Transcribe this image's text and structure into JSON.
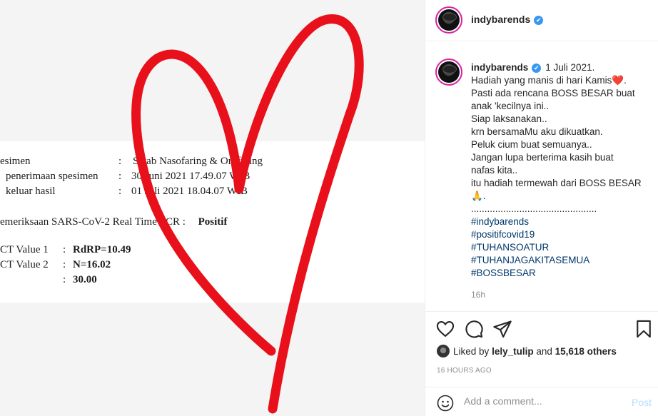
{
  "document": {
    "rows": [
      {
        "label": "esimen",
        "value": "Swab Nasofaring & Orofaring"
      },
      {
        "label": "penerimaan spesimen",
        "value": "30 Juni 2021 17.49.07 WIB"
      },
      {
        "label": "keluar hasil",
        "value": "01 Juli 2021 18.04.07 WIB"
      }
    ],
    "result_label": "emeriksaan SARS-CoV-2 Real Time PCR :",
    "result_value": "Positif",
    "ct_rows": [
      {
        "label": "CT Value 1",
        "value": "RdRP=10.49"
      },
      {
        "label": "CT Value 2",
        "value": "N=16.02"
      },
      {
        "label": "",
        "value": "30.00"
      }
    ],
    "colon": ":"
  },
  "post": {
    "username": "indybarends",
    "verified_mark": "✔",
    "date": "1 Juli 2021.",
    "caption_lines": [
      "Hadiah yang manis di hari Kamis",
      "Pasti ada rencana BOSS BESAR buat",
      "anak 'kecilnya ini..",
      "Siap laksanakan..",
      "krn bersamaMu aku dikuatkan.",
      "Peluk cium buat semuanya..",
      "Jangan lupa berterima kasih buat",
      "nafas kita..",
      "itu hadiah termewah dari BOSS BESAR",
      "🙏.",
      "..............................................."
    ],
    "heart_emoji": "❤️",
    "line1_end": ".",
    "hashtags": [
      "#indybarends",
      "#positifcovid19",
      "#TUHANSOATUR",
      "#TUHANJAGAKITASEMUA",
      "#BOSSBESAR"
    ],
    "time_ago": "16h",
    "liked_by_prefix": "Liked by",
    "liked_by_user": "lely_tulip",
    "liked_by_and": "and",
    "likes_count": "15,618 others",
    "posted_ago": "16 HOURS AGO",
    "comment_placeholder": "Add a comment...",
    "post_label": "Post"
  },
  "icons": {
    "like": "heart-icon",
    "comment": "comment-icon",
    "share": "paper-plane-icon",
    "save": "bookmark-icon",
    "emoji": "smiley-icon"
  },
  "colors": {
    "heart_stroke": "#e8101a",
    "link": "#00376b",
    "verified": "#3897f0",
    "post_button": "#b2dffc"
  }
}
